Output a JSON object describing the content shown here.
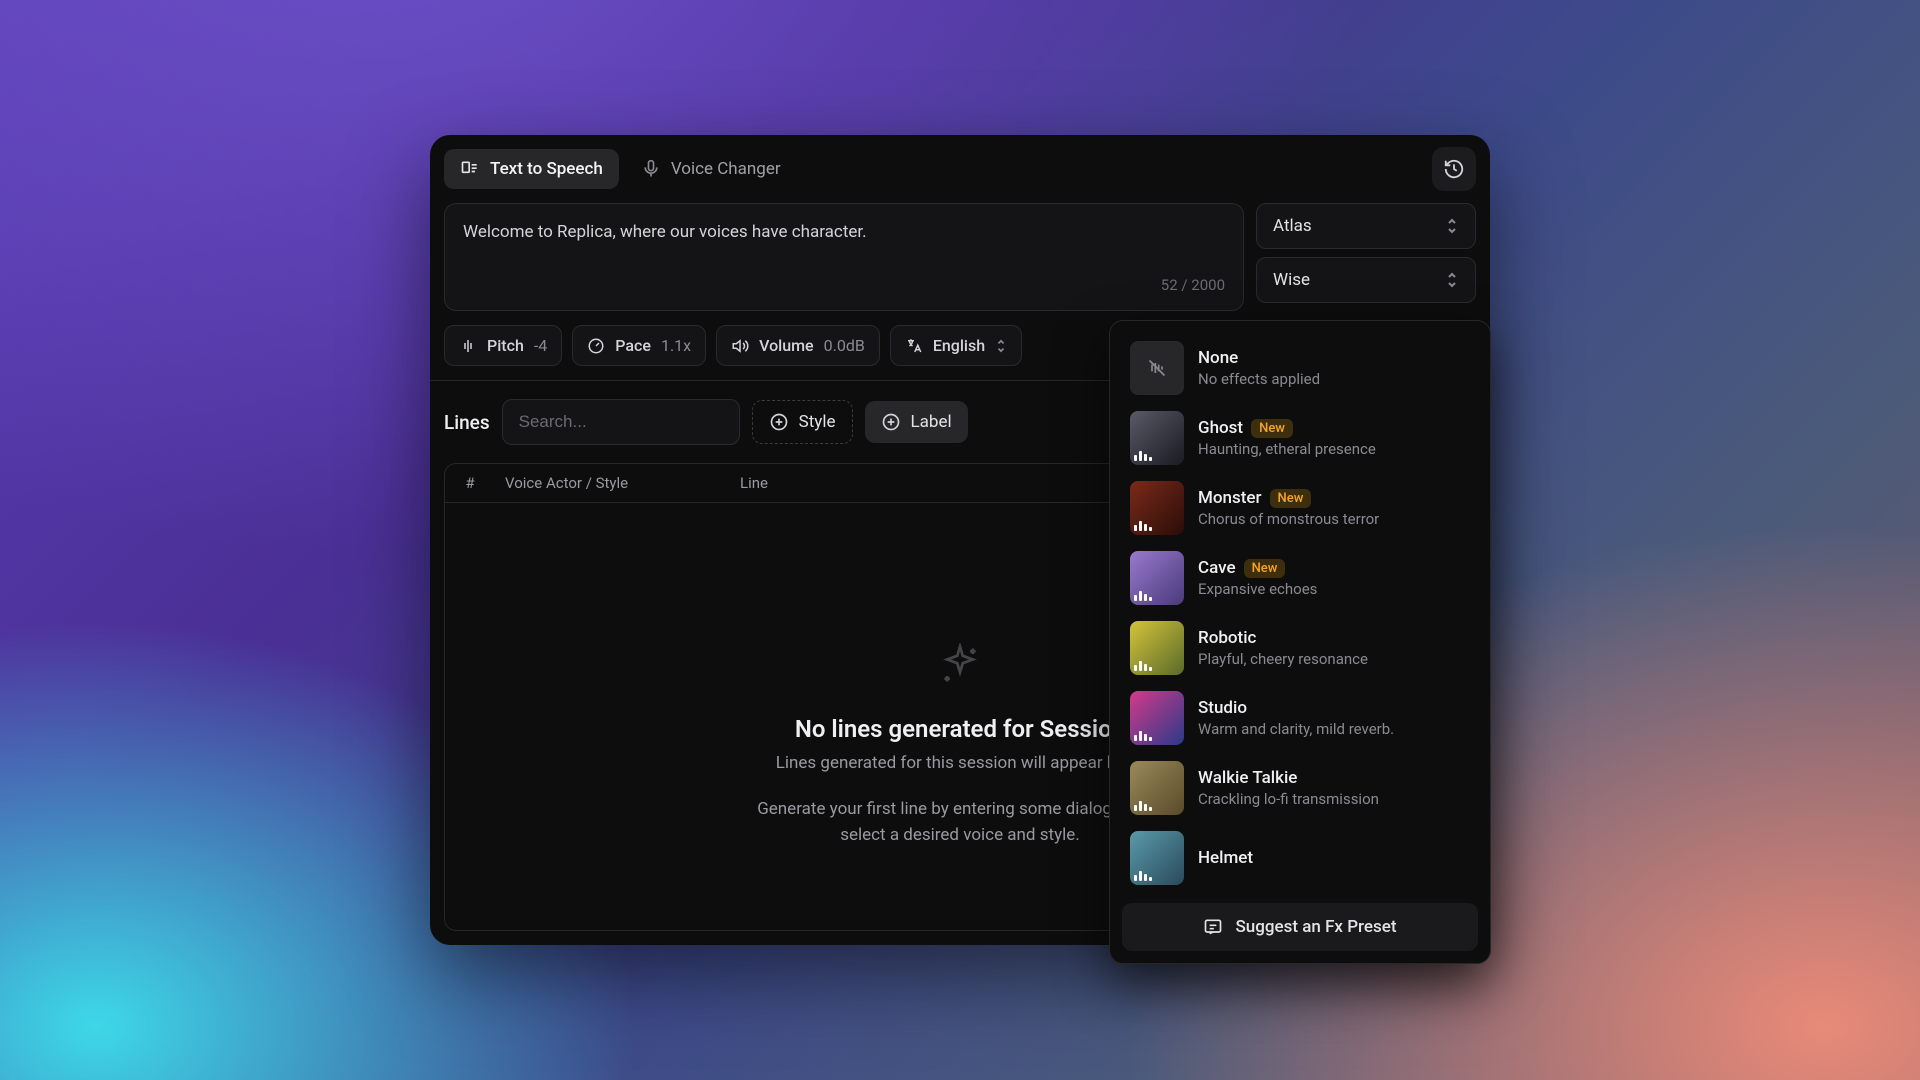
{
  "tabs": {
    "tts": "Text to Speech",
    "vc": "Voice Changer"
  },
  "textarea": {
    "value": "Welcome to Replica, where our voices have character.",
    "counter": "52 / 2000"
  },
  "selectors": {
    "voice": "Atlas",
    "style": "Wise"
  },
  "params": {
    "pitch_label": "Pitch",
    "pitch_value": "-4",
    "pace_label": "Pace",
    "pace_value": "1.1x",
    "volume_label": "Volume",
    "volume_value": "0.0dB",
    "lang_label": "English"
  },
  "lines": {
    "title": "Lines",
    "search_placeholder": "Search...",
    "style_btn": "Style",
    "label_btn": "Label"
  },
  "table": {
    "col_idx": "#",
    "col_actor": "Voice Actor / Style",
    "col_line": "Line"
  },
  "empty": {
    "title": "No lines generated for Session",
    "line1": "Lines generated for this session will appear here.",
    "line2a": "Generate your first line by entering some dialogue and",
    "line2b": "select a desired voice and style."
  },
  "fx": {
    "none_name": "None",
    "none_desc": "No effects applied",
    "presets": [
      {
        "name": "Ghost",
        "badge": "New",
        "desc": "Haunting, etheral presence",
        "bg": "linear-gradient(135deg,#4a4a55,#1a1a22)"
      },
      {
        "name": "Monster",
        "badge": "New",
        "desc": "Chorus of monstrous terror",
        "bg": "linear-gradient(135deg,#6b2a1a,#2a0d08)"
      },
      {
        "name": "Cave",
        "badge": "New",
        "desc": "Expansive echoes",
        "bg": "linear-gradient(135deg,#8a6abf,#3a2a6b)"
      },
      {
        "name": "Robotic",
        "badge": "",
        "desc": "Playful, cheery resonance",
        "bg": "linear-gradient(135deg,#d4c a3a,#3a4a2a)"
      },
      {
        "name": "Studio",
        "badge": "",
        "desc": "Warm and clarity, mild reverb.",
        "bg": "linear-gradient(135deg,#d43a8a,#2a3a8a)"
      },
      {
        "name": "Walkie Talkie",
        "badge": "",
        "desc": "Crackling lo-fi transmission",
        "bg": "linear-gradient(135deg,#8a7a4a,#4a3a1a)"
      },
      {
        "name": "Helmet",
        "badge": "",
        "desc": "",
        "bg": "linear-gradient(135deg,#4a8a9a,#1a3a4a)"
      }
    ],
    "suggest": "Suggest an Fx Preset"
  }
}
